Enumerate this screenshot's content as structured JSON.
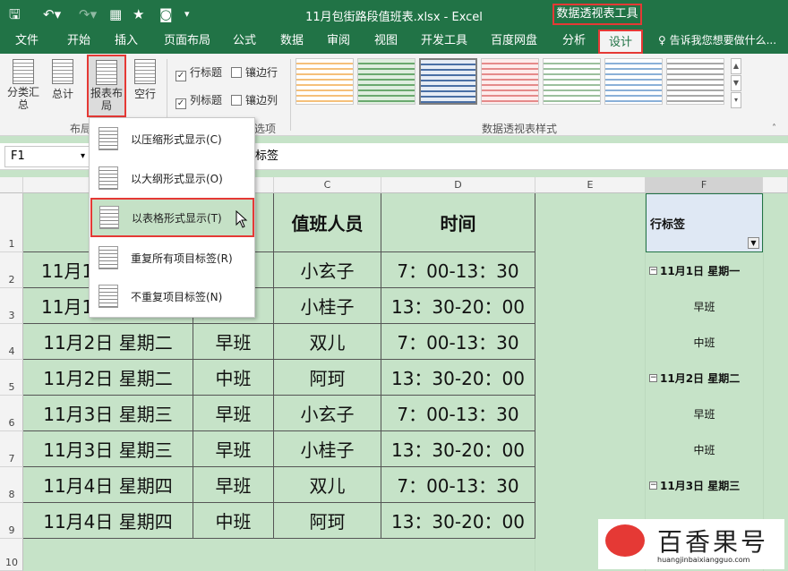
{
  "title_bar": {
    "document_title": "11月包街路段值班表.xlsx - Excel",
    "contextual_tools": "数据透视表工具"
  },
  "tabs": [
    "文件",
    "开始",
    "插入",
    "页面布局",
    "公式",
    "数据",
    "审阅",
    "视图",
    "开发工具",
    "百度网盘",
    "分析",
    "设计"
  ],
  "tell_me": "告诉我您想要做什么...",
  "ribbon": {
    "subtotals": "分类汇总",
    "grand_totals": "总计",
    "report_layout": "报表布局",
    "blank_rows": "空行",
    "layout_group": "布局",
    "row_headers": "行标题",
    "column_headers": "列标题",
    "banded_rows": "镶边行",
    "banded_columns": "镶边列",
    "options_group": "选项",
    "styles_group": "数据透视表样式"
  },
  "formula_bar": {
    "name_box": "F1",
    "content": "标签"
  },
  "menu": {
    "items": [
      "以压缩形式显示(C)",
      "以大纲形式显示(O)",
      "以表格形式显示(T)",
      "重复所有项目标签(R)",
      "不重复项目标签(N)"
    ]
  },
  "columns": [
    "C",
    "D",
    "E",
    "F"
  ],
  "rows": [
    "1",
    "2",
    "3",
    "4",
    "5",
    "6",
    "7",
    "8",
    "9",
    "10"
  ],
  "table": {
    "headers": [
      "值班人员",
      "时间"
    ],
    "rows": [
      [
        "11月1",
        "",
        "小玄子",
        "7：00-13：30"
      ],
      [
        "11月1",
        "",
        "小桂子",
        "13：30-20：00"
      ],
      [
        "11月2日 星期二",
        "早班",
        "双儿",
        "7：00-13：30"
      ],
      [
        "11月2日 星期二",
        "中班",
        "阿珂",
        "13：30-20：00"
      ],
      [
        "11月3日 星期三",
        "早班",
        "小玄子",
        "7：00-13：30"
      ],
      [
        "11月3日 星期三",
        "早班",
        "小桂子",
        "13：30-20：00"
      ],
      [
        "11月4日 星期四",
        "早班",
        "双儿",
        "7：00-13：30"
      ],
      [
        "11月4日 星期四",
        "中班",
        "阿珂",
        "13：30-20：00"
      ]
    ]
  },
  "pivot": {
    "header": "行标签",
    "rows": [
      {
        "type": "group",
        "label": "11月1日 星期一"
      },
      {
        "type": "item",
        "label": "早班"
      },
      {
        "type": "item",
        "label": "中班"
      },
      {
        "type": "group",
        "label": "11月2日 星期二"
      },
      {
        "type": "item",
        "label": "早班"
      },
      {
        "type": "item",
        "label": "中班"
      },
      {
        "type": "group",
        "label": "11月3日 星期三"
      }
    ]
  },
  "watermark": {
    "brand": "百香果号",
    "url": "huangjinbaixiangguo.com"
  },
  "colors": {
    "excel_green": "#217346",
    "sheet_bg": "#c6e3c8",
    "highlight": "#e53935"
  }
}
